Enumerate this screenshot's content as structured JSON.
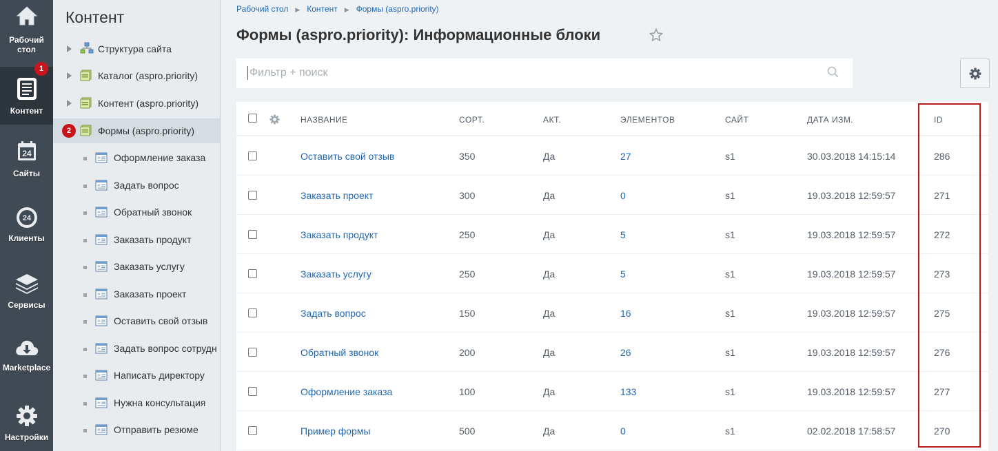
{
  "leftnav": {
    "items": [
      {
        "label1": "Рабочий",
        "label2": "стол",
        "icon": "home-icon"
      },
      {
        "label1": "Контент",
        "label2": "",
        "icon": "document-icon",
        "active": true,
        "badge": "1"
      },
      {
        "label1": "Сайты",
        "label2": "",
        "icon": "calendar-24-icon"
      },
      {
        "label1": "Клиенты",
        "label2": "",
        "icon": "bitrix24-icon"
      },
      {
        "label1": "Сервисы",
        "label2": "",
        "icon": "layers-icon"
      },
      {
        "label1": "Marketplace",
        "label2": "",
        "icon": "cloud-download-icon"
      },
      {
        "label1": "Настройки",
        "label2": "",
        "icon": "gear-icon"
      }
    ]
  },
  "tree": {
    "title": "Контент",
    "items": [
      {
        "label": "Структура сайта",
        "level": 0,
        "icon": "site-structure-icon"
      },
      {
        "label": "Каталог (aspro.priority)",
        "level": 0,
        "icon": "iblock-type-icon"
      },
      {
        "label": "Контент (aspro.priority)",
        "level": 0,
        "icon": "iblock-type-icon"
      },
      {
        "label": "Формы (aspro.priority)",
        "level": 0,
        "icon": "iblock-type-icon",
        "selected": true,
        "badge": "2"
      },
      {
        "label": "Оформление заказа",
        "level": 1
      },
      {
        "label": "Задать вопрос",
        "level": 1
      },
      {
        "label": "Обратный звонок",
        "level": 1
      },
      {
        "label": "Заказать продукт",
        "level": 1
      },
      {
        "label": "Заказать услугу",
        "level": 1
      },
      {
        "label": "Заказать проект",
        "level": 1
      },
      {
        "label": "Оставить свой отзыв",
        "level": 1
      },
      {
        "label": "Задать вопрос сотрудн",
        "level": 1
      },
      {
        "label": "Написать директору",
        "level": 1
      },
      {
        "label": "Нужна консультация",
        "level": 1
      },
      {
        "label": "Отправить резюме",
        "level": 1
      }
    ]
  },
  "breadcrumb": [
    "Рабочий стол",
    "Контент",
    "Формы (aspro.priority)"
  ],
  "page_title": "Формы (aspro.priority): Информационные блоки",
  "search": {
    "placeholder": "Фильтр + поиск"
  },
  "table": {
    "columns": [
      "НАЗВАНИЕ",
      "СОРТ.",
      "АКТ.",
      "ЭЛЕМЕНТОВ",
      "САЙТ",
      "ДАТА ИЗМ.",
      "ID"
    ],
    "rows": [
      {
        "name": "Оставить свой отзыв",
        "sort": "350",
        "active": "Да",
        "elements": "27",
        "site": "s1",
        "date": "30.03.2018 14:15:14",
        "id": "286"
      },
      {
        "name": "Заказать проект",
        "sort": "300",
        "active": "Да",
        "elements": "0",
        "site": "s1",
        "date": "19.03.2018 12:59:57",
        "id": "271"
      },
      {
        "name": "Заказать продукт",
        "sort": "250",
        "active": "Да",
        "elements": "5",
        "site": "s1",
        "date": "19.03.2018 12:59:57",
        "id": "272"
      },
      {
        "name": "Заказать услугу",
        "sort": "250",
        "active": "Да",
        "elements": "5",
        "site": "s1",
        "date": "19.03.2018 12:59:57",
        "id": "273"
      },
      {
        "name": "Задать вопрос",
        "sort": "150",
        "active": "Да",
        "elements": "16",
        "site": "s1",
        "date": "19.03.2018 12:59:57",
        "id": "275"
      },
      {
        "name": "Обратный звонок",
        "sort": "200",
        "active": "Да",
        "elements": "26",
        "site": "s1",
        "date": "19.03.2018 12:59:57",
        "id": "276"
      },
      {
        "name": "Оформление заказа",
        "sort": "100",
        "active": "Да",
        "elements": "133",
        "site": "s1",
        "date": "19.03.2018 12:59:57",
        "id": "277"
      },
      {
        "name": "Пример формы",
        "sort": "500",
        "active": "Да",
        "elements": "0",
        "site": "s1",
        "date": "02.02.2018 17:58:57",
        "id": "270"
      }
    ]
  },
  "colors": {
    "accent_link": "#2067b0",
    "highlight_border": "#b71c1c",
    "badge": "#c8151b",
    "nav_bg": "#3f4a55"
  }
}
